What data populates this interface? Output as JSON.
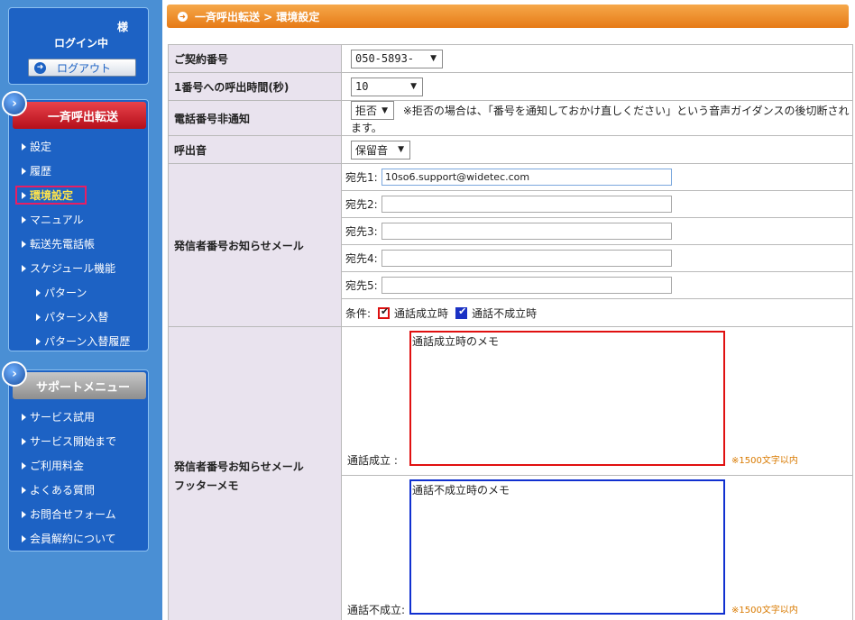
{
  "login": {
    "honorific": "様",
    "status": "ログイン中",
    "logout_label": "ログアウト"
  },
  "menu": {
    "title": "一斉呼出転送",
    "items": [
      {
        "label": "設定"
      },
      {
        "label": "履歴"
      },
      {
        "label": "環境設定"
      },
      {
        "label": "マニュアル"
      },
      {
        "label": "転送先電話帳"
      },
      {
        "label": "スケジュール機能"
      },
      {
        "label": "パターン"
      },
      {
        "label": "パターン入替"
      },
      {
        "label": "パターン入替履歴"
      }
    ]
  },
  "support": {
    "title": "サポートメニュー",
    "items": [
      {
        "label": "サービス試用"
      },
      {
        "label": "サービス開始まで"
      },
      {
        "label": "ご利用料金"
      },
      {
        "label": "よくある質問"
      },
      {
        "label": "お問合せフォーム"
      },
      {
        "label": "会員解約について"
      }
    ]
  },
  "page": {
    "breadcrumb": "一斉呼出転送 > 環境設定"
  },
  "form": {
    "contract": {
      "label": "ご契約番号",
      "value": "050-5893-"
    },
    "call_time": {
      "label": "1番号への呼出時間(秒)",
      "value": "10"
    },
    "hidden_number": {
      "label": "電話番号非通知",
      "value": "拒否",
      "note": "※拒否の場合は、「番号を通知しておかけ直しください」という音声ガイダンスの後切断されます。"
    },
    "ring_tone": {
      "label": "呼出音",
      "value": "保留音"
    },
    "notify_mail": {
      "label": "発信者番号お知らせメール",
      "addresses": [
        {
          "label": "宛先1:",
          "value": "10so6.support@widetec.com"
        },
        {
          "label": "宛先2:",
          "value": ""
        },
        {
          "label": "宛先3:",
          "value": ""
        },
        {
          "label": "宛先4:",
          "value": ""
        },
        {
          "label": "宛先5:",
          "value": ""
        }
      ],
      "condition_label": "条件:",
      "cond_success": "通話成立時",
      "cond_fail": "通話不成立時"
    },
    "footer_memo": {
      "label_line1": "発信者番号お知らせメール",
      "label_line2": "フッターメモ",
      "success_label": "通話成立 :",
      "success_text": "通話成立時のメモ",
      "fail_label": "通話不成立:",
      "fail_text": "通話不成立時のメモ",
      "limit_note": "※1500文字以内"
    }
  },
  "colors": {
    "accent_red": "#e01010",
    "accent_blue": "#1030d0",
    "title_orange": "#e67a16",
    "sidebar_blue": "#4a8fd4"
  }
}
